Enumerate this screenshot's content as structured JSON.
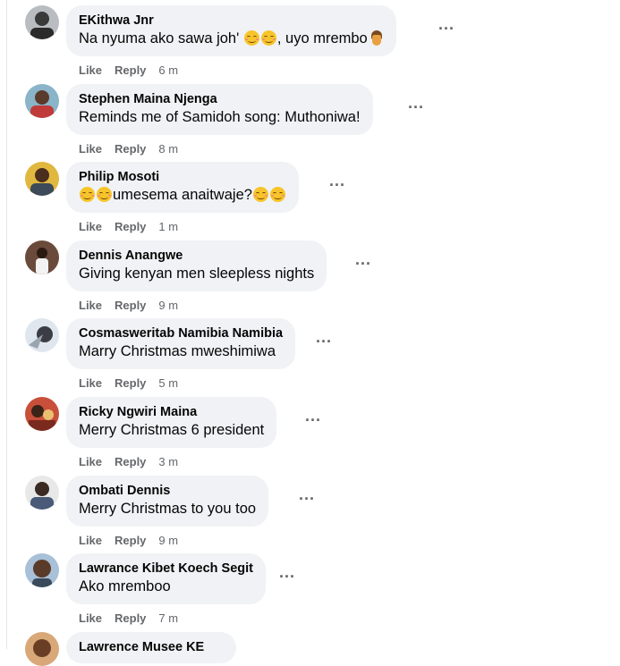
{
  "more_icon": "...",
  "comments": [
    {
      "author": "EKithwa Jnr",
      "text": "Na nyuma ako sawa joh' ",
      "emojis": [
        "smiling-face",
        "smiling-face"
      ],
      "text_after": ", uyo mrembo",
      "like": "Like",
      "reply": "Reply",
      "time": "6 m"
    },
    {
      "author": "Stephen Maina Njenga",
      "text": "Reminds me of Samidoh song: Muthoniwa!",
      "like": "Like",
      "reply": "Reply",
      "time": "8 m"
    },
    {
      "author": "Philip Mosoti",
      "text": "umesema anaitwaje?",
      "like": "Like",
      "reply": "Reply",
      "time": "1 m"
    },
    {
      "author": "Dennis Anangwe",
      "text": "Giving kenyan men sleepless nights",
      "like": "Like",
      "reply": "Reply",
      "time": "9 m"
    },
    {
      "author": "Cosmasweritab Namibia Namibia",
      "text": "Marry Christmas mweshimiwa",
      "like": "Like",
      "reply": "Reply",
      "time": "5 m"
    },
    {
      "author": "Ricky Ngwiri Maina",
      "text": "Merry Christmas 6 president",
      "like": "Like",
      "reply": "Reply",
      "time": "3 m"
    },
    {
      "author": "Ombati Dennis",
      "text": "Merry Christmas to you too",
      "like": "Like",
      "reply": "Reply",
      "time": "9 m"
    },
    {
      "author": "Lawrance Kibet Koech Segit",
      "text": "Ako mremboo",
      "like": "Like",
      "reply": "Reply",
      "time": "7 m"
    },
    {
      "author": "Lawrence Musee KE"
    }
  ]
}
